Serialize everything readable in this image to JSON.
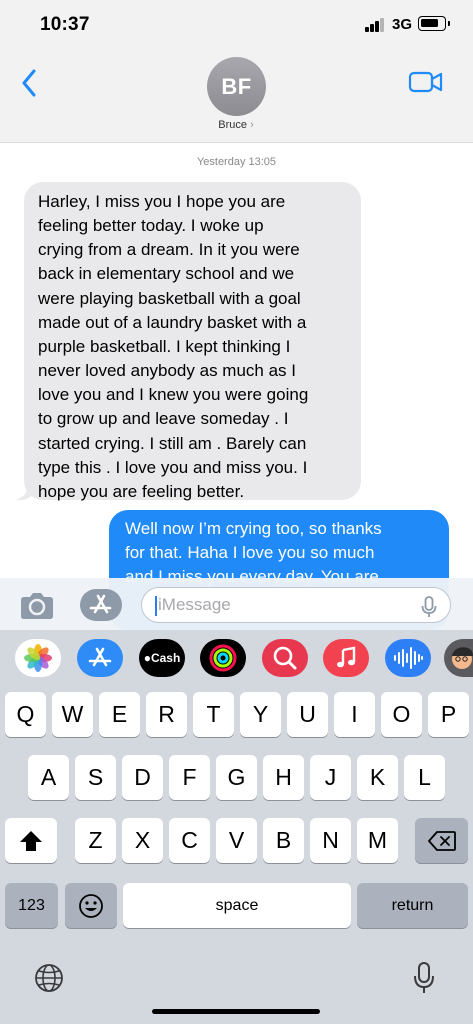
{
  "status_bar": {
    "time": "10:37",
    "network": "3G",
    "signal_bars": 3
  },
  "header": {
    "back_icon": "chevron-left-icon",
    "video_icon": "video-camera-icon",
    "avatar_initials": "BF",
    "contact_name": "Bruce",
    "contact_chevron": "›"
  },
  "conversation": {
    "timestamp": "Yesterday 13:05",
    "messages": [
      {
        "direction": "incoming",
        "lines": [
          "Harley, I miss you I hope you are",
          "feeling better today. I woke up",
          "crying from a dream. In it you were",
          "back in elementary school and we",
          "were playing basketball with a goal",
          "made out of a laundry basket with a",
          "purple basketball. I kept thinking I",
          "never loved anybody as much as I",
          "love you and I knew you were going",
          "to grow up and leave someday . I",
          "started crying. I still am . Barely can",
          "type this . I love you and miss you. I",
          "hope you are feeling better."
        ]
      },
      {
        "direction": "outgoing",
        "lines": [
          "Well now I’m crying too, so thanks",
          "for that. Haha I love you so much",
          "and I miss you every day. You are"
        ]
      }
    ]
  },
  "composer": {
    "camera_icon": "camera-icon",
    "apps_icon": "app-store-icon",
    "placeholder": "iMessage",
    "mic_icon": "microphone-icon"
  },
  "app_strip": [
    {
      "name": "Photos",
      "icon": "photos-icon"
    },
    {
      "name": "App Store",
      "icon": "app-store-icon"
    },
    {
      "name": "Cash",
      "label": "Cash",
      "icon": "apple-cash-icon"
    },
    {
      "name": "Activity",
      "icon": "activity-rings-icon"
    },
    {
      "name": "Search",
      "icon": "web-search-icon"
    },
    {
      "name": "Music",
      "icon": "music-note-icon"
    },
    {
      "name": "Audio",
      "icon": "audio-waveform-icon"
    },
    {
      "name": "Memoji",
      "icon": "memoji-icon"
    }
  ],
  "keyboard": {
    "row1": [
      "Q",
      "W",
      "E",
      "R",
      "T",
      "Y",
      "U",
      "I",
      "O",
      "P"
    ],
    "row2": [
      "A",
      "S",
      "D",
      "F",
      "G",
      "H",
      "J",
      "K",
      "L"
    ],
    "row3": [
      "Z",
      "X",
      "C",
      "V",
      "B",
      "N",
      "M"
    ],
    "numbers_label": "123",
    "space_label": "space",
    "return_label": "return",
    "shift_icon": "shift-icon",
    "delete_icon": "delete-icon",
    "emoji_icon": "emoji-icon",
    "globe_icon": "globe-icon",
    "dictation_icon": "microphone-icon"
  },
  "colors": {
    "accent": "#1f8af8",
    "incoming_bubble": "#e9e9eb",
    "keyboard_bg": "#d3d7de",
    "key_bg": "#ffffff",
    "special_key_bg": "#abb2bd"
  }
}
